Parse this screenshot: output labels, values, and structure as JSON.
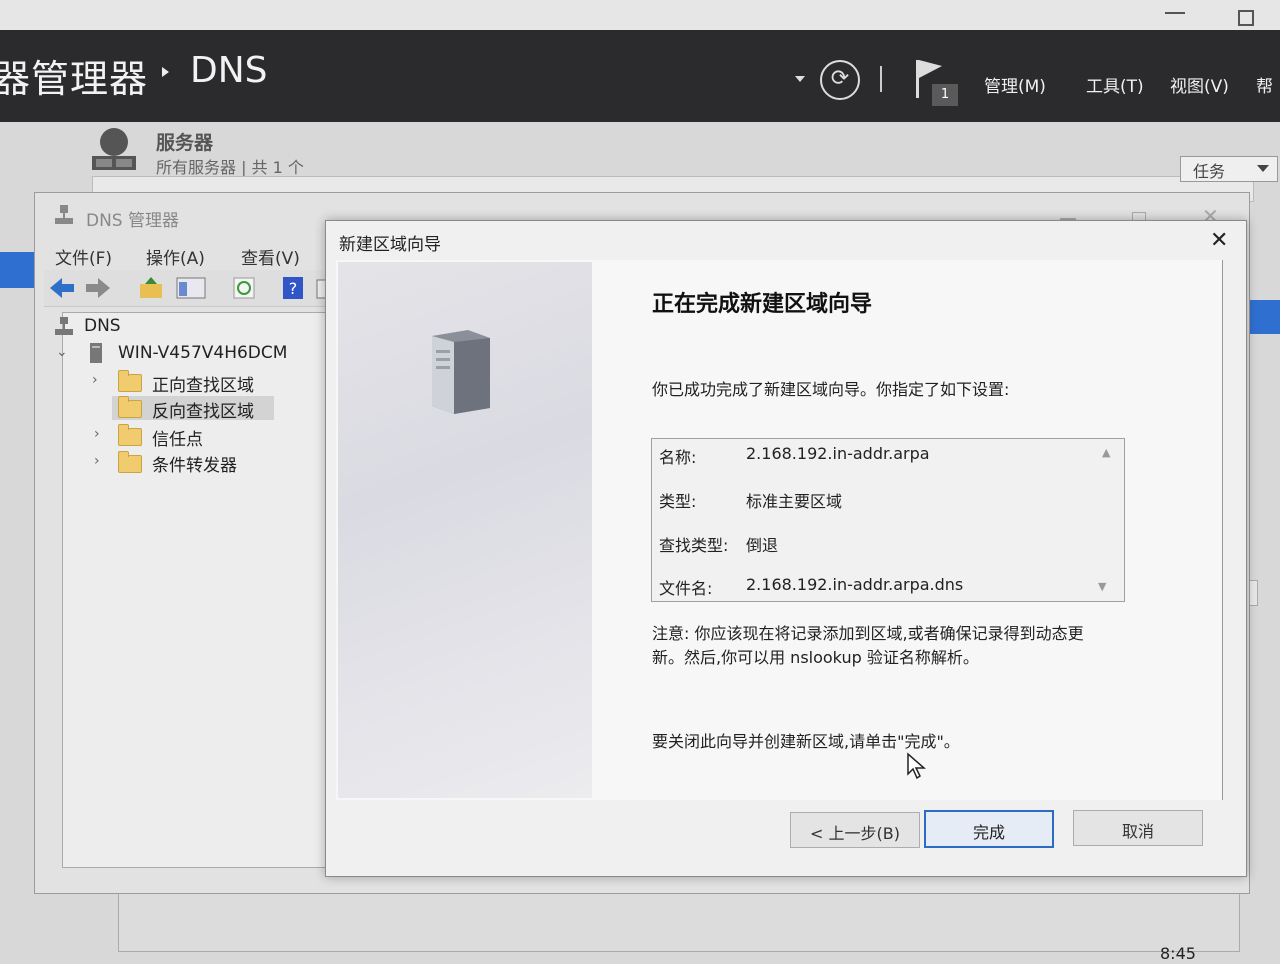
{
  "server_manager": {
    "title_fragment": "器管理器",
    "breadcrumb_current": "DNS",
    "notification_count": "1",
    "menus": [
      "管理(M)",
      "工具(T)",
      "视图(V)",
      "帮"
    ],
    "servers_title": "服务器",
    "servers_subtitle": "所有服务器 | 共 1 个",
    "tasks_label": "任务",
    "clock": "8:45"
  },
  "dns_manager": {
    "title": "DNS 管理器",
    "menu": [
      "文件(F)",
      "操作(A)",
      "查看(V)"
    ],
    "tree": {
      "root": "DNS",
      "server": "WIN-V457V4H6DCM",
      "children": [
        "正向查找区域",
        "反向查找区域",
        "信任点",
        "条件转发器"
      ],
      "selected": "反向查找区域"
    }
  },
  "wizard": {
    "title": "新建区域向导",
    "heading": "正在完成新建区域向导",
    "intro": "你已成功完成了新建区域向导。你指定了如下设置:",
    "settings": [
      {
        "label": "名称:",
        "value": "2.168.192.in-addr.arpa"
      },
      {
        "label": "类型:",
        "value": "标准主要区域"
      },
      {
        "label": "查找类型:",
        "value": "倒退"
      },
      {
        "label": "文件名:",
        "value": "2.168.192.in-addr.arpa.dns"
      }
    ],
    "note_line1": "注意: 你应该现在将记录添加到区域,或者确保记录得到动态更",
    "note_line2": "新。然后,你可以用 nslookup 验证名称解析。",
    "finish_hint": "要关闭此向导并创建新区域,请单击\"完成\"。",
    "buttons": {
      "back": "< 上一步(B)",
      "finish": "完成",
      "cancel": "取消"
    }
  },
  "colors": {
    "accent_blue": "#2f6fd0",
    "header_dark": "#2b2b2d",
    "folder_yellow": "#f0cc6e"
  }
}
